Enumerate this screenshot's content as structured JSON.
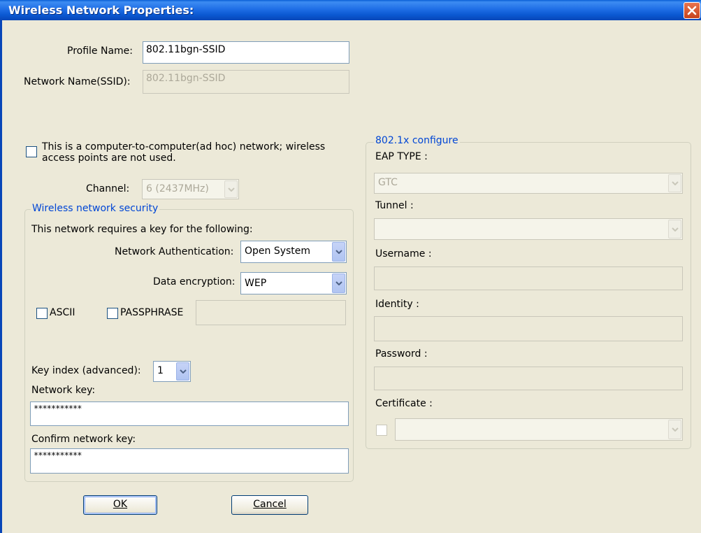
{
  "window": {
    "title": "Wireless Network Properties:"
  },
  "profile": {
    "profile_name_label": "Profile Name:",
    "profile_name_value": "802.11bgn-SSID",
    "ssid_label": "Network Name(SSID):",
    "ssid_value": "802.11bgn-SSID"
  },
  "adhoc": {
    "checkbox_text_line1": "This is a computer-to-computer(ad hoc) network; wireless",
    "checkbox_text_line2": "access points are not used.",
    "checked": false,
    "channel_label": "Channel:",
    "channel_value": "6  (2437MHz)"
  },
  "security": {
    "group_title": "Wireless network security",
    "requires_key_text": "This network requires a key for the following:",
    "auth_label": "Network Authentication:",
    "auth_value": "Open System",
    "encryption_label": "Data encryption:",
    "encryption_value": "WEP",
    "ascii_label": "ASCII",
    "passphrase_label": "PASSPHRASE",
    "passphrase_value": "",
    "key_index_label": "Key index (advanced):",
    "key_index_value": "1",
    "network_key_label": "Network key:",
    "network_key_value": "***********",
    "confirm_key_label": "Confirm network key:",
    "confirm_key_value": "***********"
  },
  "dot1x": {
    "group_title": "802.1x configure",
    "eap_type_label": "EAP TYPE :",
    "eap_type_value": "GTC",
    "tunnel_label": "Tunnel :",
    "tunnel_value": "",
    "username_label": "Username :",
    "username_value": "",
    "identity_label": "Identity :",
    "identity_value": "",
    "password_label": "Password :",
    "password_value": "",
    "certificate_label": "Certificate :",
    "certificate_value": ""
  },
  "buttons": {
    "ok_label": "OK",
    "cancel_label": "Cancel"
  },
  "icons": {
    "close": "close-icon",
    "dropdown": "chevron-down-icon"
  },
  "colors": {
    "titlebar": "#0a57d0",
    "dialog_bg": "#ece9d8",
    "group_title": "#0046d5",
    "close_button": "#d8552e"
  }
}
